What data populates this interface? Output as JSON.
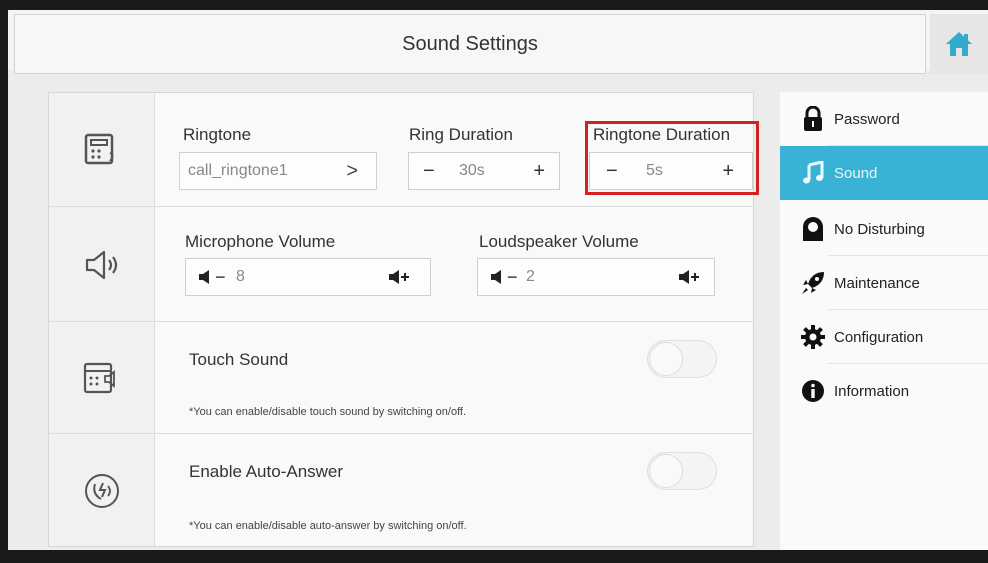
{
  "header": {
    "title": "Sound Settings"
  },
  "ringtone_row": {
    "ringtone_label": "Ringtone",
    "ringtone_value": "call_ringtone1",
    "ring_duration_label": "Ring Duration",
    "ring_duration_value": "30s",
    "ringtone_duration_label": "Ringtone Duration",
    "ringtone_duration_value": "5s",
    "minus": "−",
    "plus": "+",
    "chevron": ">"
  },
  "volume_row": {
    "mic_label": "Microphone Volume",
    "mic_value": "8",
    "speaker_label": "Loudspeaker Volume",
    "speaker_value": "2",
    "minus": "−"
  },
  "touch_row": {
    "label": "Touch Sound",
    "note": "*You can enable/disable touch sound by switching on/off."
  },
  "auto_answer_row": {
    "label": "Enable Auto-Answer",
    "note": "*You can enable/disable auto-answer by switching on/off."
  },
  "sidebar": {
    "items": [
      {
        "label": "Password",
        "icon": "lock-icon"
      },
      {
        "label": "Sound",
        "icon": "music-note-icon",
        "active": true
      },
      {
        "label": "No Disturbing",
        "icon": "do-not-disturb-icon"
      },
      {
        "label": "Maintenance",
        "icon": "rocket-icon"
      },
      {
        "label": "Configuration",
        "icon": "gear-icon"
      },
      {
        "label": "Information",
        "icon": "info-icon"
      }
    ]
  },
  "colors": {
    "accent": "#39b2d6",
    "highlight": "#d32020"
  }
}
